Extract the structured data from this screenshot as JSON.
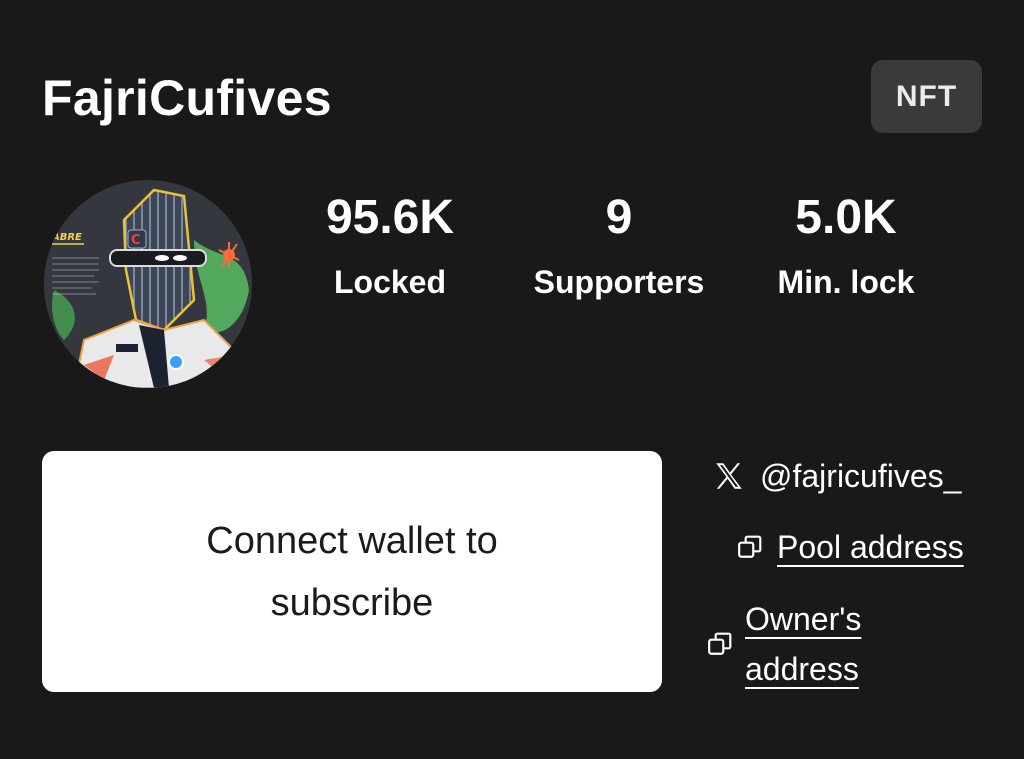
{
  "header": {
    "title": "FajriCufives",
    "badge": "NFT"
  },
  "avatar": {
    "icon": "creator-avatar-image",
    "badge_text": "ABRE",
    "letter": "C"
  },
  "stats": [
    {
      "value": "95.6K",
      "label": "Locked"
    },
    {
      "value": "9",
      "label": "Supporters"
    },
    {
      "value": "5.0K",
      "label": "Min. lock"
    }
  ],
  "connect": {
    "label": "Connect wallet to subscribe"
  },
  "links": {
    "twitter": {
      "icon": "x-logo-icon",
      "handle": "@fajricufives_"
    },
    "pool": {
      "icon": "copy-icon",
      "label": "Pool address"
    },
    "owner": {
      "icon": "copy-icon",
      "label_line1": "Owner's",
      "label_line2": "address"
    }
  },
  "colors": {
    "background": "#1a1818",
    "badge_bg": "#3a3a3a",
    "card_bg": "#ffffff",
    "text": "#ffffff"
  }
}
